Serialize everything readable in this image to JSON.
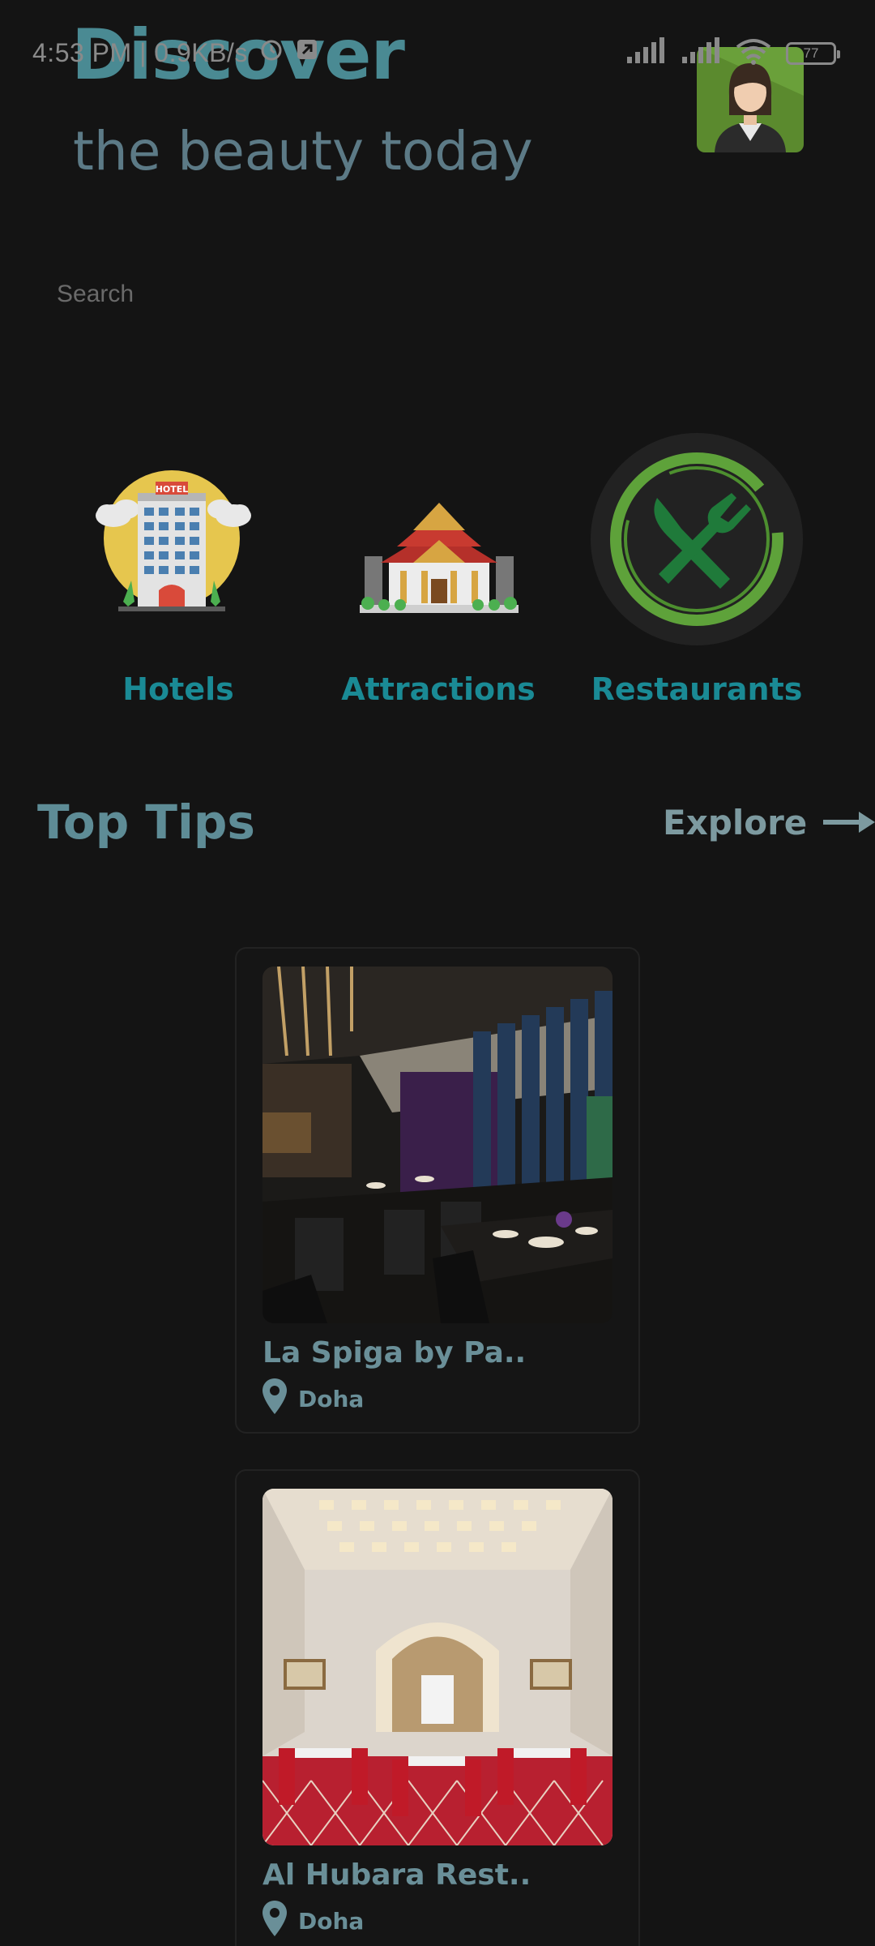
{
  "status_bar": {
    "time_speed": "4:53 PM | 0.9KB/s",
    "battery": "77"
  },
  "header": {
    "title": "Discover",
    "subtitle": "the beauty today"
  },
  "search": {
    "placeholder": "Search"
  },
  "categories": [
    {
      "label": "Hotels",
      "icon": "hotel-icon"
    },
    {
      "label": "Attractions",
      "icon": "temple-icon"
    },
    {
      "label": "Restaurants",
      "icon": "fork-knife-icon"
    }
  ],
  "top_tips": {
    "title": "Top Tips",
    "explore_label": "Explore"
  },
  "cards": [
    {
      "name": "La Spiga by Pa..",
      "location": "Doha"
    },
    {
      "name": "Al Hubara Rest..",
      "location": "Doha"
    }
  ],
  "colors": {
    "background": "#141414",
    "accent_teal": "#1a8a95",
    "title_teal": "#4a8a93",
    "muted_blue": "#5c7a86"
  }
}
